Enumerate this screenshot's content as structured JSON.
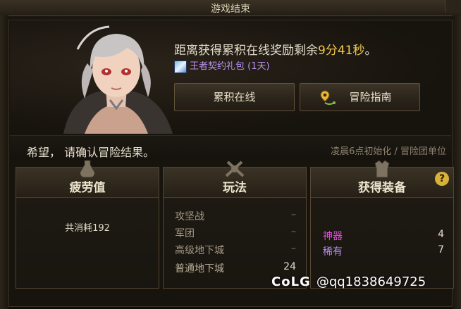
{
  "window": {
    "title": "游戏结束"
  },
  "reward": {
    "prefix": "距离获得累积在线奖励剩余",
    "time": "9分41秒",
    "suffix": "。",
    "gift_label": "王者契约礼包 (1天)"
  },
  "buttons": {
    "online": "累积在线",
    "guide": "冒险指南"
  },
  "confirm_text": "希望，  请确认冒险结果。",
  "reset_text": "凌晨6点初始化 / 冒险团单位",
  "fatigue_panel": {
    "title": "疲劳值",
    "text": "共消耗192"
  },
  "play_panel": {
    "title": "玩法",
    "rows": [
      {
        "label": "攻坚战",
        "value": "–"
      },
      {
        "label": "军团",
        "value": "–"
      },
      {
        "label": "高级地下城",
        "value": "–"
      },
      {
        "label": "普通地下城",
        "value": "24"
      }
    ]
  },
  "equip_panel": {
    "title": "获得装备",
    "help": "?",
    "rows": [
      {
        "label": "神器",
        "value": "4",
        "color": "#e04bdc"
      },
      {
        "label": "稀有",
        "value": "7",
        "color": "#b58cf0"
      }
    ]
  },
  "watermark": {
    "logo": "CoLG",
    "handle": "@qq1838649725"
  },
  "colors": {
    "accent_time": "#f1c94a",
    "gift": "#b991f0",
    "artifact": "#e04bdc",
    "rare": "#b58cf0"
  }
}
